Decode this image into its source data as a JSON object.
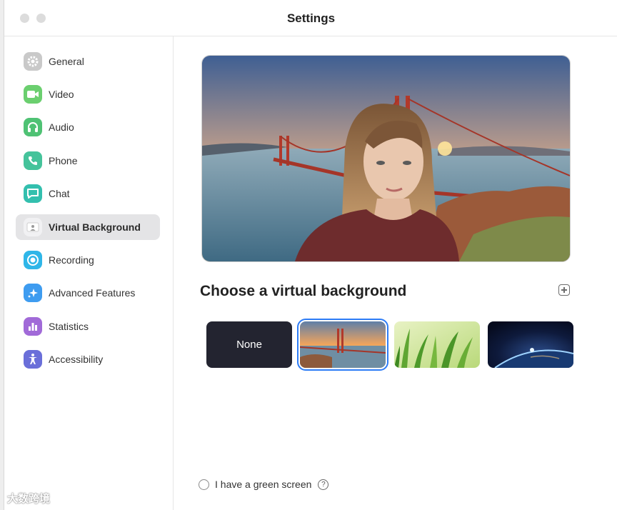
{
  "window": {
    "title": "Settings"
  },
  "sidebar": {
    "items": [
      {
        "label": "General",
        "icon": "gear-icon",
        "color": "#c8c8c8"
      },
      {
        "label": "Video",
        "icon": "video-camera-icon",
        "color": "#6bcf6f"
      },
      {
        "label": "Audio",
        "icon": "headphones-icon",
        "color": "#4fc274"
      },
      {
        "label": "Phone",
        "icon": "phone-icon",
        "color": "#45c39b"
      },
      {
        "label": "Chat",
        "icon": "chat-bubble-icon",
        "color": "#33bfae"
      },
      {
        "label": "Virtual Background",
        "icon": "person-portrait-icon",
        "color": "#e8e8ea"
      },
      {
        "label": "Recording",
        "icon": "record-icon",
        "color": "#2fb6e8"
      },
      {
        "label": "Advanced Features",
        "icon": "sparkle-icon",
        "color": "#3e9cf0"
      },
      {
        "label": "Statistics",
        "icon": "bar-chart-icon",
        "color": "#a16ad8"
      },
      {
        "label": "Accessibility",
        "icon": "accessibility-icon",
        "color": "#6a6fd9"
      }
    ],
    "active": "Virtual Background"
  },
  "main": {
    "section_title": "Choose a virtual background",
    "backgrounds": [
      {
        "label": "None",
        "kind": "none"
      },
      {
        "label": "",
        "kind": "golden-gate-bridge",
        "selected": true
      },
      {
        "label": "",
        "kind": "grass"
      },
      {
        "label": "",
        "kind": "earth-from-space"
      }
    ],
    "green_screen_label": "I have a green screen",
    "green_screen_checked": false
  },
  "watermark": "大数跨境",
  "colors": {
    "accent": "#2d7cf6",
    "active_bg": "#e4e4e6"
  }
}
